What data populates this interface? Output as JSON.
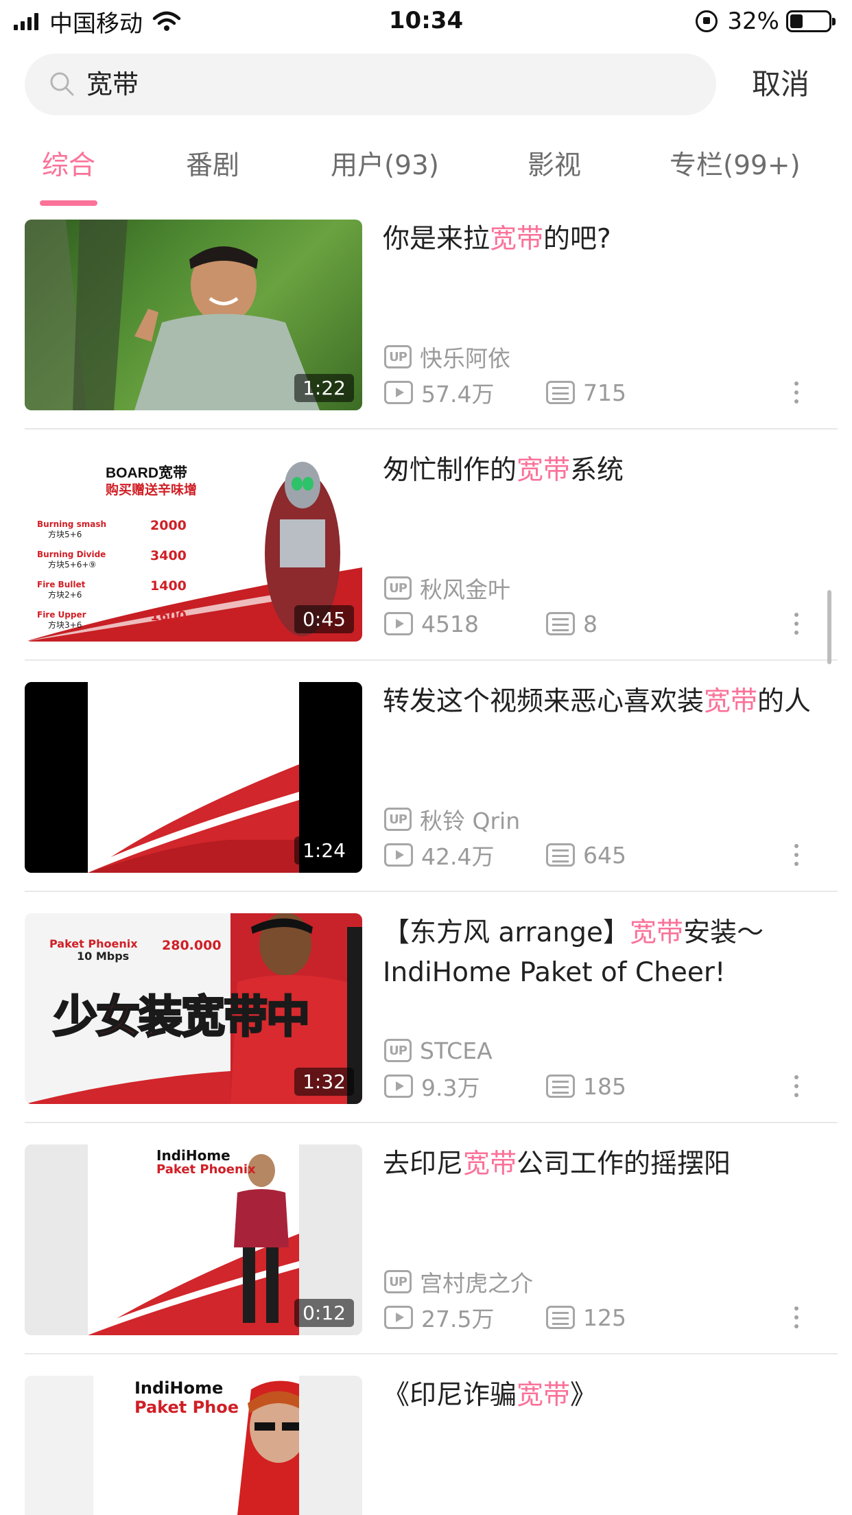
{
  "status_bar": {
    "carrier": "中国移动",
    "time": "10:34",
    "battery": "32%"
  },
  "search": {
    "query": "宽带",
    "cancel_label": "取消"
  },
  "tabs": [
    {
      "label": "综合"
    },
    {
      "label": "番剧"
    },
    {
      "label": "用户(93)"
    },
    {
      "label": "影视"
    },
    {
      "label": "专栏(99+)"
    }
  ],
  "colors": {
    "accent": "#fb7299",
    "meta": "#9a9a9a"
  },
  "results": [
    {
      "title_before": "你是来拉",
      "title_highlight": "宽带",
      "title_after": "的吧?",
      "duration": "1:22",
      "uploader": "快乐阿依",
      "views": "57.4万",
      "danmaku": "715",
      "thumb_style": "forest"
    },
    {
      "title_before": "匆忙制作的",
      "title_highlight": "宽带",
      "title_after": "系统",
      "duration": "0:45",
      "uploader": "秋风金叶",
      "views": "4518",
      "danmaku": "8",
      "thumb_style": "board",
      "thumb_text": {
        "heading": "BOARD宽带",
        "subheading": "购买赠送辛味增",
        "rows": [
          {
            "name": "Burning smash",
            "combo": "方块5+6",
            "price": "2000"
          },
          {
            "name": "Burning Divide",
            "combo": "方块5+6+⑨",
            "price": "3400"
          },
          {
            "name": "Fire Bullet",
            "combo": "方块2+6",
            "price": "1400"
          },
          {
            "name": "Fire Upper",
            "combo": "方块3+6",
            "price": "1600"
          }
        ]
      }
    },
    {
      "title_before": "转发这个视频来恶心喜欢装",
      "title_highlight": "宽带",
      "title_after": "的人",
      "duration": "1:24",
      "uploader": "秋铃 Qrin",
      "views": "42.4万",
      "danmaku": "645",
      "thumb_style": "blank"
    },
    {
      "title_before": "【东方风 arrange】",
      "title_highlight": "宽带",
      "title_after": "安装～IndiHome Paket of Cheer!",
      "duration": "1:32",
      "uploader": "STCEA",
      "views": "9.3万",
      "danmaku": "185",
      "thumb_style": "indihome-overlay",
      "thumb_text": {
        "overlay": "少女装宽带中",
        "price": "280.000",
        "speed": "10 Mbps"
      }
    },
    {
      "title_before": "去印尼",
      "title_highlight": "宽带",
      "title_after": "公司工作的摇摆阳",
      "duration": "0:12",
      "uploader": "宫村虎之介",
      "views": "27.5万",
      "danmaku": "125",
      "thumb_style": "indihome-flyer",
      "thumb_text": {
        "heading": "IndiHome",
        "subheading": "Paket Phoenix"
      }
    },
    {
      "title_before": "《印尼诈骗",
      "title_highlight": "宽带",
      "title_after": "》",
      "duration": "",
      "uploader": "",
      "views": "",
      "danmaku": "",
      "thumb_style": "indihome-flyer",
      "thumb_text": {
        "heading": "IndiHome",
        "subheading": "Paket Phoe"
      }
    }
  ],
  "icons": {
    "up_badge": "UP"
  }
}
